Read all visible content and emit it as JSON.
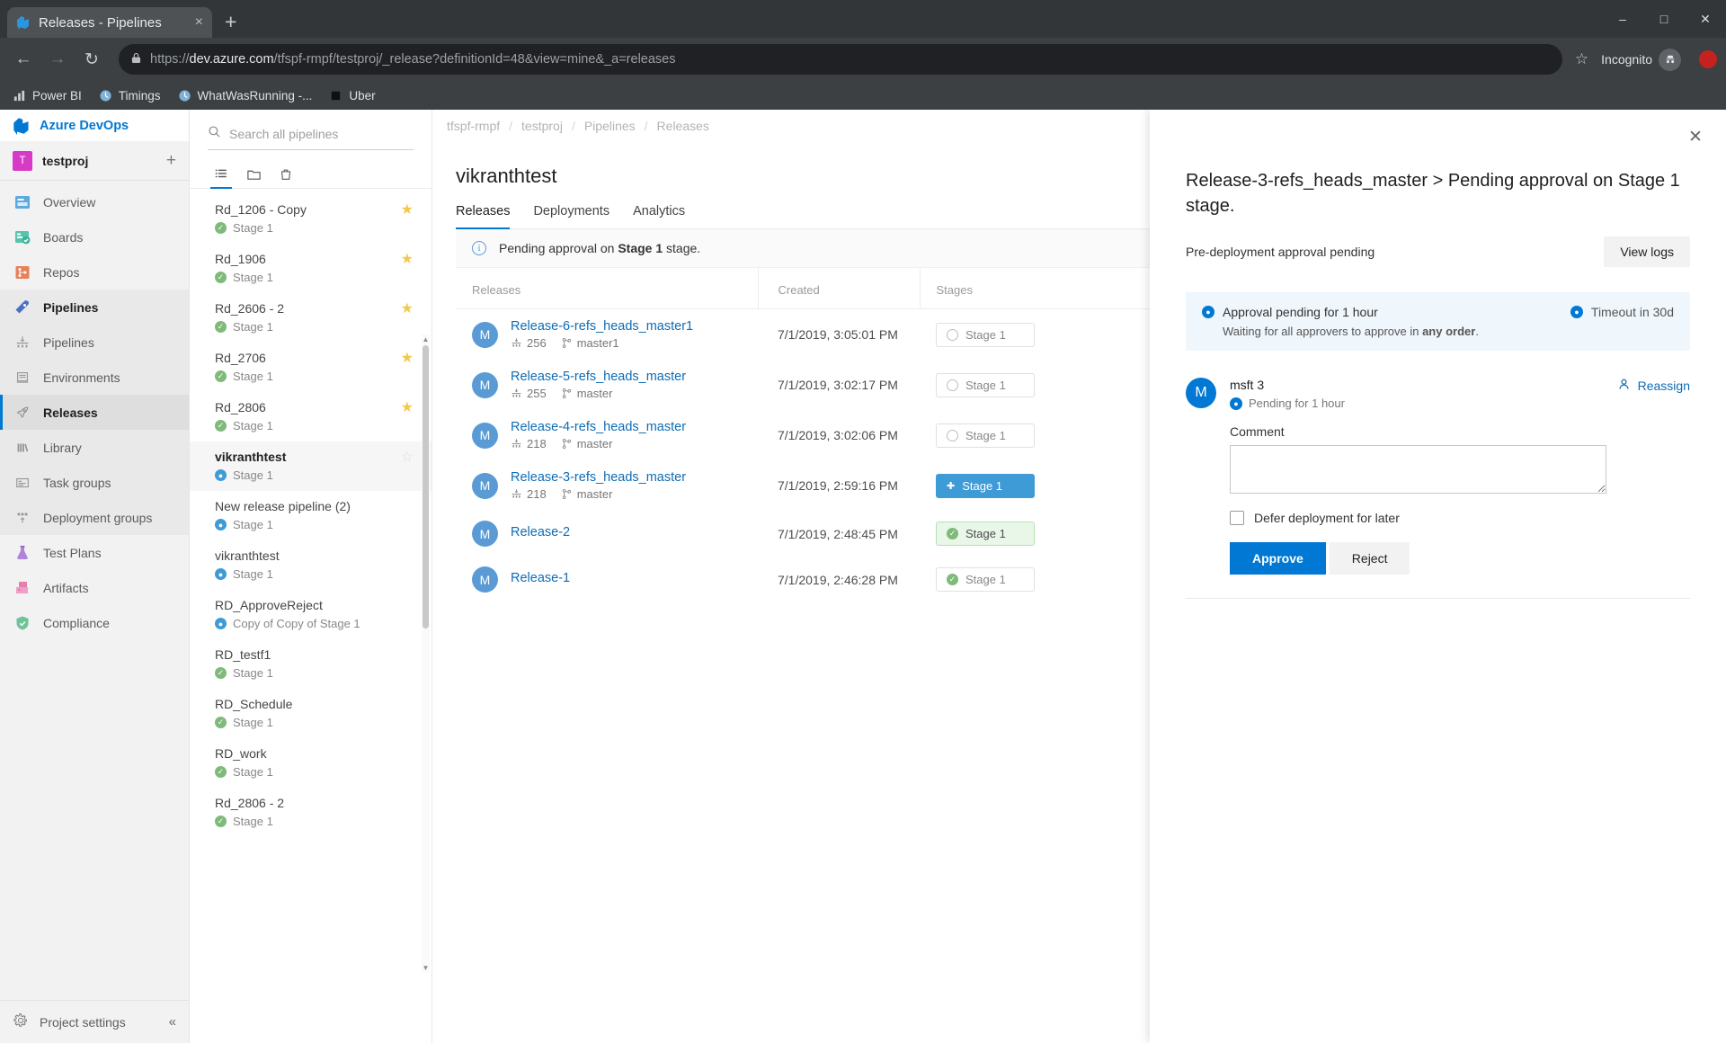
{
  "browser": {
    "tab": {
      "title": "Releases - Pipelines",
      "favicon": "azure-devops-icon",
      "close_label": "×"
    },
    "new_tab_label": "+",
    "window_controls": {
      "minimize": "–",
      "maximize": "□",
      "close": "✕"
    },
    "nav": {
      "back": "←",
      "forward": "→",
      "reload": "↻"
    },
    "omnibox": {
      "lock": "🔒",
      "url_scheme": "https://",
      "url_host": "dev.azure.com",
      "url_path": "/tfspf-rmpf/testproj/_release?definitionId=48&view=mine&_a=releases",
      "star": "☆"
    },
    "incognito_label": "Incognito",
    "bookmarks": [
      {
        "label": "Power BI",
        "icon": "power-bi-icon"
      },
      {
        "label": "Timings",
        "icon": "clock-icon"
      },
      {
        "label": "WhatWasRunning -...",
        "icon": "clock-icon"
      },
      {
        "label": "Uber",
        "icon": "square-icon"
      }
    ]
  },
  "rail": {
    "brand": "Azure DevOps",
    "project": {
      "initial": "T",
      "name": "testproj",
      "add_label": "+"
    },
    "items": [
      {
        "label": "Overview",
        "icon": "overview-icon",
        "state": "normal"
      },
      {
        "label": "Boards",
        "icon": "boards-icon",
        "state": "normal"
      },
      {
        "label": "Repos",
        "icon": "repos-icon",
        "state": "normal"
      },
      {
        "label": "Pipelines",
        "icon": "pipelines-icon",
        "state": "group-active"
      },
      {
        "label": "Pipelines",
        "icon": "pipelines-sub-icon",
        "state": "sub"
      },
      {
        "label": "Environments",
        "icon": "environments-icon",
        "state": "sub"
      },
      {
        "label": "Releases",
        "icon": "releases-rocket-icon",
        "state": "selected"
      },
      {
        "label": "Library",
        "icon": "library-icon",
        "state": "sub"
      },
      {
        "label": "Task groups",
        "icon": "task-groups-icon",
        "state": "sub"
      },
      {
        "label": "Deployment groups",
        "icon": "deployment-groups-icon",
        "state": "sub"
      },
      {
        "label": "Test Plans",
        "icon": "test-plans-icon",
        "state": "normal"
      },
      {
        "label": "Artifacts",
        "icon": "artifacts-icon",
        "state": "normal"
      },
      {
        "label": "Compliance",
        "icon": "compliance-icon",
        "state": "normal"
      }
    ],
    "footer": {
      "label": "Project settings",
      "icon": "gear-icon",
      "collapse": "«"
    }
  },
  "pipeline_panel": {
    "search_placeholder": "Search all pipelines",
    "search_value": "",
    "tools": [
      {
        "name": "all-pipelines-view",
        "glyph": "list-icon"
      },
      {
        "name": "folders-view",
        "glyph": "folder-icon"
      },
      {
        "name": "recycle-bin",
        "glyph": "trash-icon"
      }
    ],
    "items": [
      {
        "name": "Rd_1206 - Copy",
        "stage": "Stage 1",
        "status": "ok",
        "fav": true,
        "selected": false
      },
      {
        "name": "Rd_1906",
        "stage": "Stage 1",
        "status": "ok",
        "fav": true,
        "selected": false
      },
      {
        "name": "Rd_2606 - 2",
        "stage": "Stage 1",
        "status": "ok",
        "fav": true,
        "selected": false
      },
      {
        "name": "Rd_2706",
        "stage": "Stage 1",
        "status": "ok",
        "fav": true,
        "selected": false
      },
      {
        "name": "Rd_2806",
        "stage": "Stage 1",
        "status": "ok",
        "fav": true,
        "selected": false
      },
      {
        "name": "vikranthtest",
        "stage": "Stage 1",
        "status": "pending",
        "fav": false,
        "selected": true
      },
      {
        "name": "New release pipeline (2)",
        "stage": "Stage 1",
        "status": "pending",
        "fav": false,
        "selected": false
      },
      {
        "name": "vikranthtest",
        "stage": "Stage 1",
        "status": "pending",
        "fav": false,
        "selected": false
      },
      {
        "name": "RD_ApproveReject",
        "stage": "Copy of Copy of Stage 1",
        "status": "pending",
        "fav": false,
        "selected": false
      },
      {
        "name": "RD_testf1",
        "stage": "Stage 1",
        "status": "ok",
        "fav": false,
        "selected": false
      },
      {
        "name": "RD_Schedule",
        "stage": "Stage 1",
        "status": "ok",
        "fav": false,
        "selected": false
      },
      {
        "name": "RD_work",
        "stage": "Stage 1",
        "status": "ok",
        "fav": false,
        "selected": false
      },
      {
        "name": "Rd_2806 - 2",
        "stage": "Stage 1",
        "status": "ok",
        "fav": false,
        "selected": false
      }
    ]
  },
  "main": {
    "breadcrumb": [
      "tfspf-rmpf",
      "testproj",
      "Pipelines",
      "Releases"
    ],
    "title": "vikranthtest",
    "tabs": [
      {
        "label": "Releases",
        "active": true
      },
      {
        "label": "Deployments",
        "active": false
      },
      {
        "label": "Analytics",
        "active": false
      }
    ],
    "banner": {
      "prefix": "Pending approval on ",
      "bold": "Stage 1",
      "suffix": " stage."
    },
    "table": {
      "headers": [
        "Releases",
        "Created",
        "Stages"
      ],
      "rows": [
        {
          "avatar": "M",
          "name": "Release-6-refs_heads_master1",
          "build": "256",
          "branch": "master1",
          "created": "7/1/2019, 3:05:01 PM",
          "stage": "Stage 1",
          "stage_state": "notstarted"
        },
        {
          "avatar": "M",
          "name": "Release-5-refs_heads_master",
          "build": "255",
          "branch": "master",
          "created": "7/1/2019, 3:02:17 PM",
          "stage": "Stage 1",
          "stage_state": "notstarted"
        },
        {
          "avatar": "M",
          "name": "Release-4-refs_heads_master",
          "build": "218",
          "branch": "master",
          "created": "7/1/2019, 3:02:06 PM",
          "stage": "Stage 1",
          "stage_state": "notstarted"
        },
        {
          "avatar": "M",
          "name": "Release-3-refs_heads_master",
          "build": "218",
          "branch": "master",
          "created": "7/1/2019, 2:59:16 PM",
          "stage": "Stage 1",
          "stage_state": "pending"
        },
        {
          "avatar": "M",
          "name": "Release-2",
          "build": "",
          "branch": "",
          "created": "7/1/2019, 2:48:45 PM",
          "stage": "Stage 1",
          "stage_state": "succeeded-highlight"
        },
        {
          "avatar": "M",
          "name": "Release-1",
          "build": "",
          "branch": "",
          "created": "7/1/2019, 2:46:28 PM",
          "stage": "Stage 1",
          "stage_state": "succeeded"
        }
      ]
    }
  },
  "approval_panel": {
    "close_label": "✕",
    "title": "Release-3-refs_heads_master > Pending approval on Stage 1 stage.",
    "subtitle": "Pre-deployment approval pending",
    "view_logs_label": "View logs",
    "info": {
      "pending_text": "Approval pending for 1 hour",
      "timeout_text": "Timeout in 30d",
      "waiting_prefix": "Waiting for all approvers to approve in ",
      "waiting_bold": "any order",
      "waiting_suffix": "."
    },
    "approver": {
      "avatar": "M",
      "name": "msft 3",
      "status": "Pending for 1 hour",
      "reassign_label": "Reassign"
    },
    "comment_label": "Comment",
    "comment_value": "",
    "comment_placeholder": "",
    "defer_label": "Defer deployment for later",
    "approve_label": "Approve",
    "reject_label": "Reject"
  },
  "colors": {
    "accent": "#0078d4",
    "link": "#0e6cb5",
    "pending_badge": "#3f9bd6",
    "success": "#7fba7a",
    "info_bg": "#eff6fc"
  }
}
